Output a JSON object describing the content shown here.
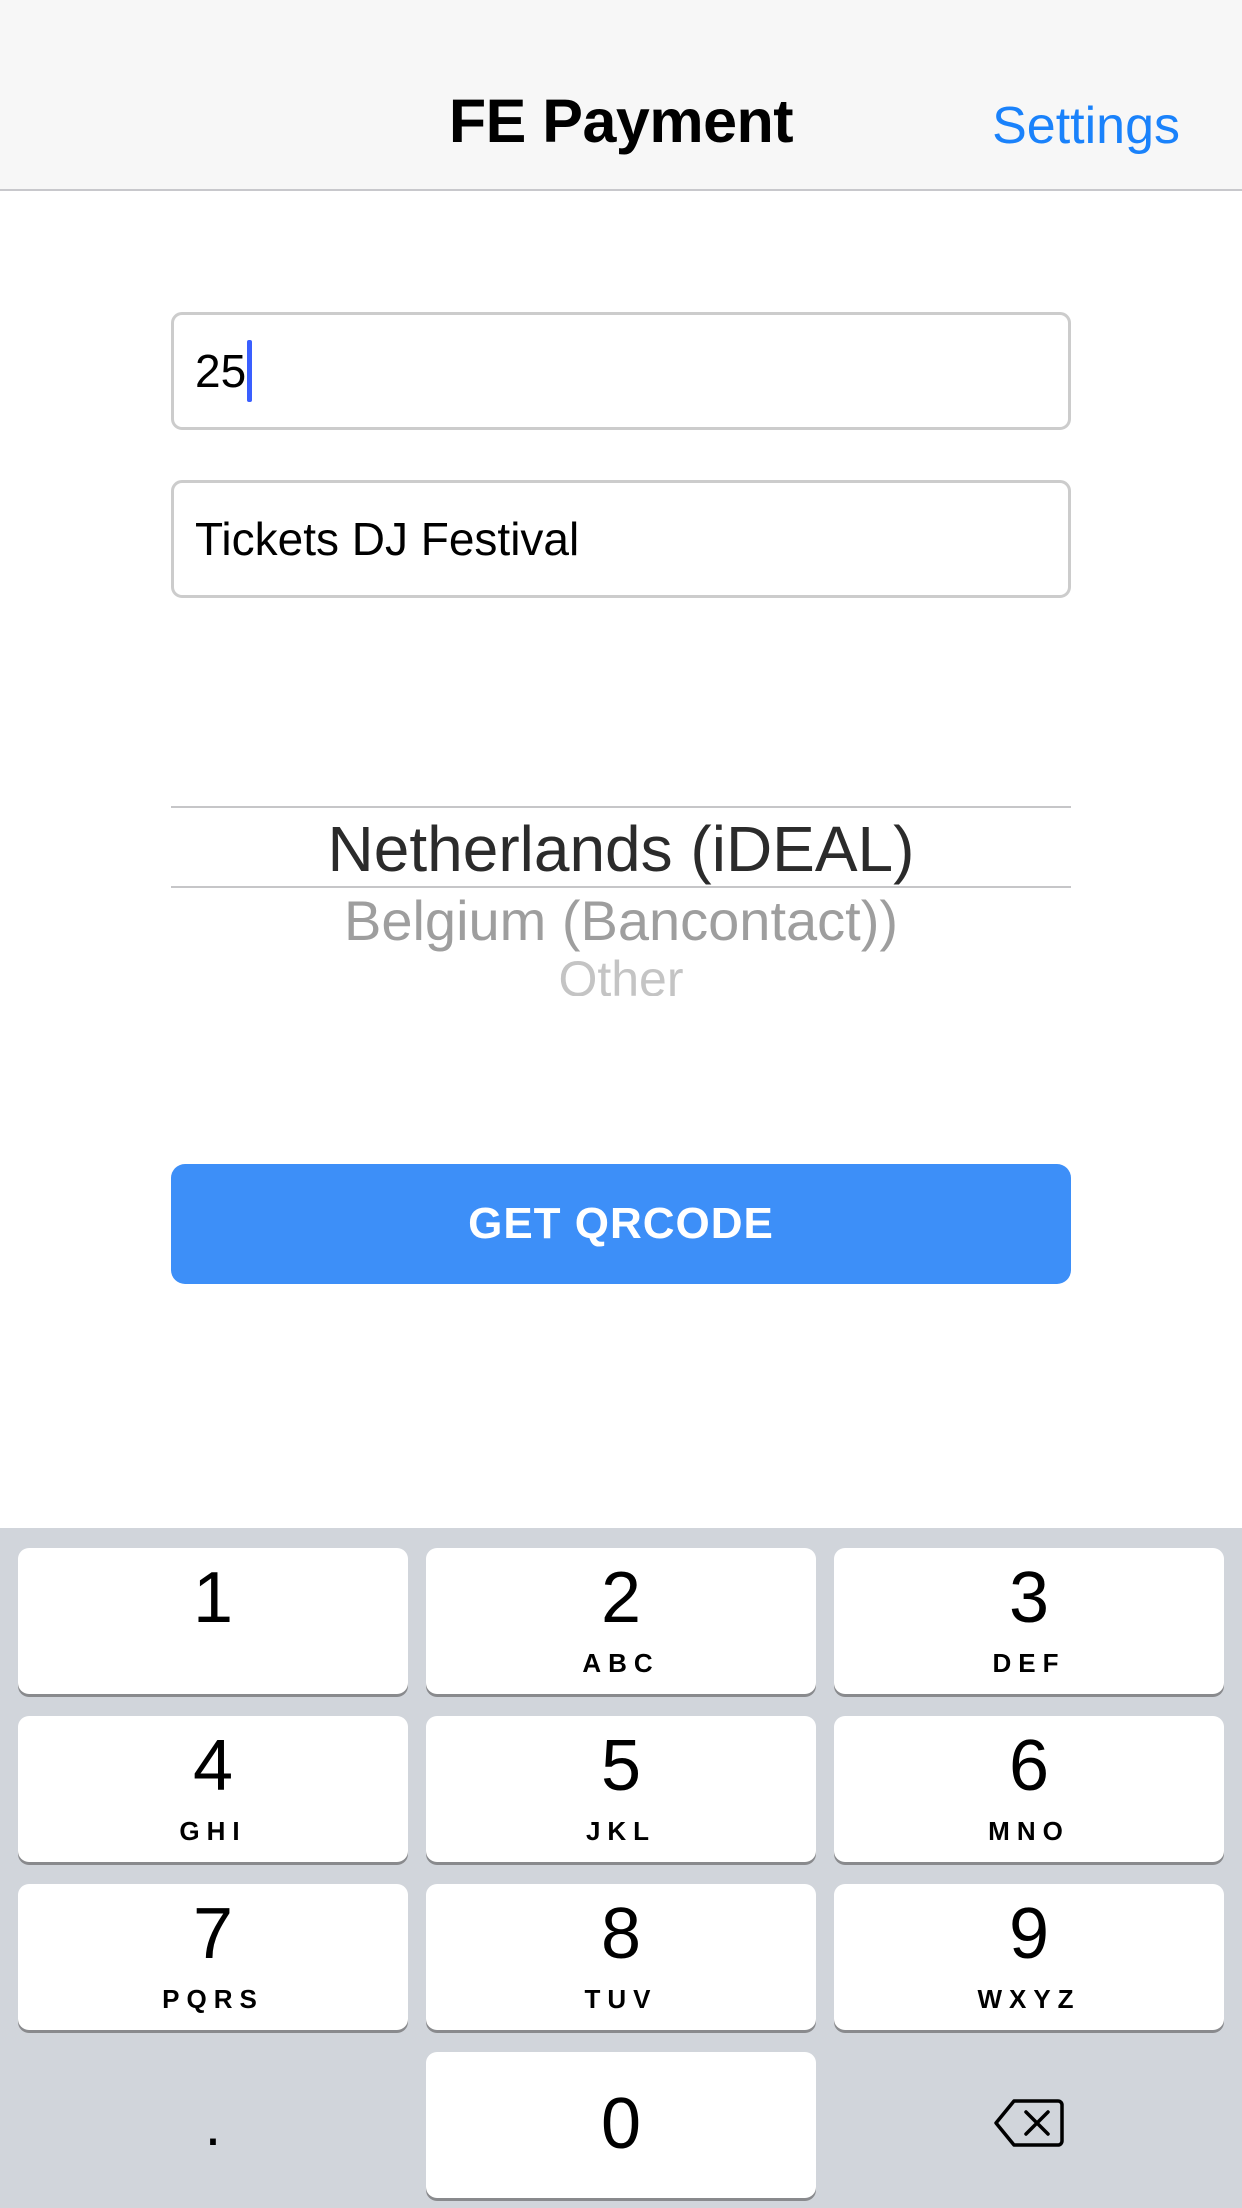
{
  "nav": {
    "title": "FE Payment",
    "settings_label": "Settings"
  },
  "form": {
    "amount_value": "25",
    "description_value": "Tickets DJ Festival"
  },
  "picker": {
    "selected": "Netherlands (iDEAL)",
    "options": [
      "Netherlands (iDEAL)",
      "Belgium (Bancontact))",
      "Other"
    ]
  },
  "cta_label": "GET QRCODE",
  "keypad": {
    "keys": [
      {
        "num": "1",
        "letters": ""
      },
      {
        "num": "2",
        "letters": "ABC"
      },
      {
        "num": "3",
        "letters": "DEF"
      },
      {
        "num": "4",
        "letters": "GHI"
      },
      {
        "num": "5",
        "letters": "JKL"
      },
      {
        "num": "6",
        "letters": "MNO"
      },
      {
        "num": "7",
        "letters": "PQRS"
      },
      {
        "num": "8",
        "letters": "TUV"
      },
      {
        "num": "9",
        "letters": "WXYZ"
      }
    ],
    "zero": "0",
    "decimal": "."
  },
  "colors": {
    "accent": "#1a82fb",
    "button": "#3d8ff8",
    "caret": "#3a5fff",
    "keyboard_bg": "#d1d5db"
  },
  "icons": {
    "delete": "delete-backspace-icon"
  }
}
